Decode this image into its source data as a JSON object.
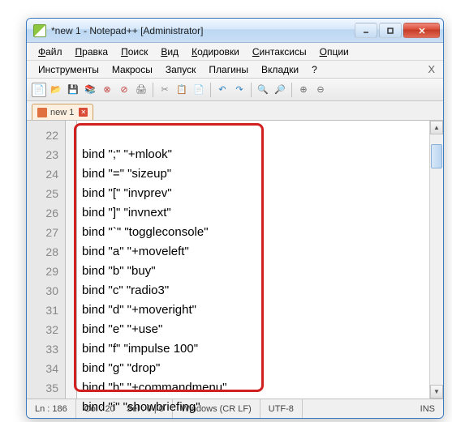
{
  "window": {
    "title": "*new 1 - Notepad++ [Administrator]"
  },
  "menu": {
    "row1": [
      "Файл",
      "Правка",
      "Поиск",
      "Вид",
      "Кодировки",
      "Синтаксисы",
      "Опции"
    ],
    "row2": [
      "Инструменты",
      "Макросы",
      "Запуск",
      "Плагины",
      "Вкладки",
      "?"
    ]
  },
  "tab": {
    "label": "new 1"
  },
  "gutter": [
    22,
    23,
    24,
    25,
    26,
    27,
    28,
    29,
    30,
    31,
    32,
    33,
    34,
    35
  ],
  "code_lines": [
    "bind \";\" \"+mlook\"",
    "bind \"=\" \"sizeup\"",
    "bind \"[\" \"invprev\"",
    "bind \"]\" \"invnext\"",
    "bind \"`\" \"toggleconsole\"",
    "bind \"a\" \"+moveleft\"",
    "bind \"b\" \"buy\"",
    "bind \"c\" \"radio3\"",
    "bind \"d\" \"+moveright\"",
    "bind \"e\" \"+use\"",
    "bind \"f\" \"impulse 100\"",
    "bind \"g\" \"drop\"",
    "bind \"h\" \"+commandmenu\"",
    "bind \"i\" \"showbriefing\""
  ],
  "status": {
    "line": "Ln : 186",
    "col": "Col : 20",
    "sel": "Sel : 0 | 0",
    "eol": "Windows (CR LF)",
    "enc": "UTF-8",
    "mode": "INS"
  },
  "toolbar_icons": [
    "new",
    "open",
    "save",
    "saveall",
    "close",
    "closeall",
    "print",
    "",
    "cut",
    "copy",
    "paste",
    "",
    "undo",
    "redo",
    "",
    "find",
    "replace",
    "",
    "zoomin",
    "zoomout"
  ]
}
